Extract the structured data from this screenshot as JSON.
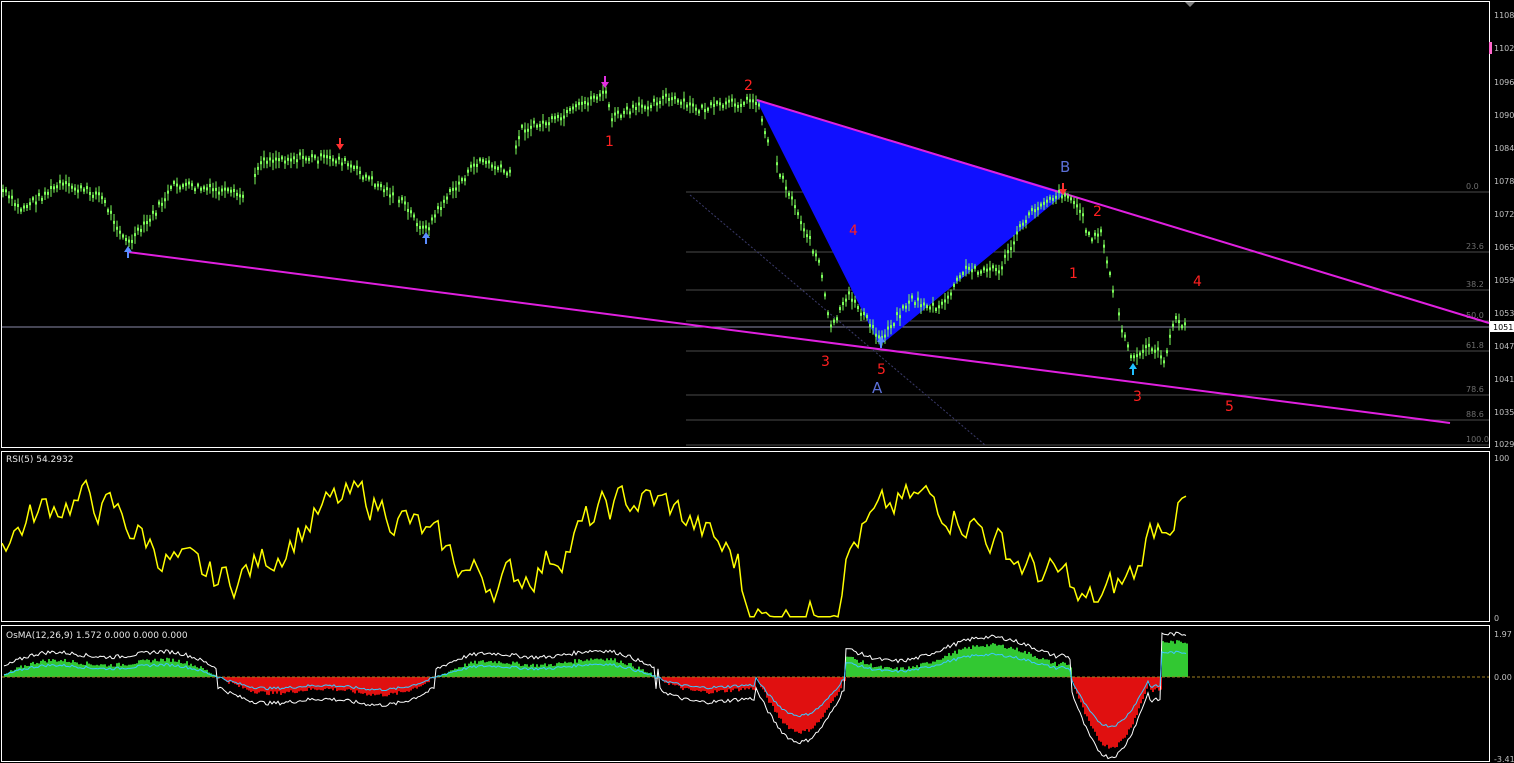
{
  "colors": {
    "background": "#000000",
    "frame": "#ffffff",
    "candle_up": "#7cfc5a",
    "trendline": "#e020e0",
    "triangle_fill": "#1010ff",
    "rsi_line": "#ffff00",
    "osma_pos": "#32c832",
    "osma_neg": "#e01010",
    "osma_line": "#3cc8ff",
    "wave_label": "#ff2020",
    "point_label": "#5b6fd6",
    "arrow_down": "#ff4040",
    "arrow_up": "#4aa0ff"
  },
  "chart_data": [
    {
      "type": "candlestick",
      "panel": "price",
      "y_ticks": [
        "1108",
        "1102",
        "1096",
        "1090",
        "1084",
        "1078",
        "1072",
        "1065",
        "1059",
        "1053",
        "1047",
        "1041",
        "1035",
        "1029"
      ],
      "current_price_label": "1051",
      "fib_levels": [
        "0.0",
        "23.6",
        "38.2",
        "50.0",
        "61.8",
        "78.6",
        "88.6",
        "100.0"
      ],
      "wave_labels": [
        "1",
        "2",
        "3",
        "4",
        "5",
        "1",
        "2",
        "3",
        "4",
        "5"
      ],
      "point_labels": [
        "A",
        "B"
      ]
    },
    {
      "type": "line",
      "panel": "rsi",
      "label": "RSI(5) 54.2932",
      "y_ticks": [
        "100",
        "0"
      ]
    },
    {
      "type": "bar",
      "panel": "osma",
      "label": "OsMA(12,26,9) 1.572 0.000 0.000 0.000",
      "y_ticks": [
        "1.97",
        "0.00",
        "-3.41"
      ]
    }
  ]
}
